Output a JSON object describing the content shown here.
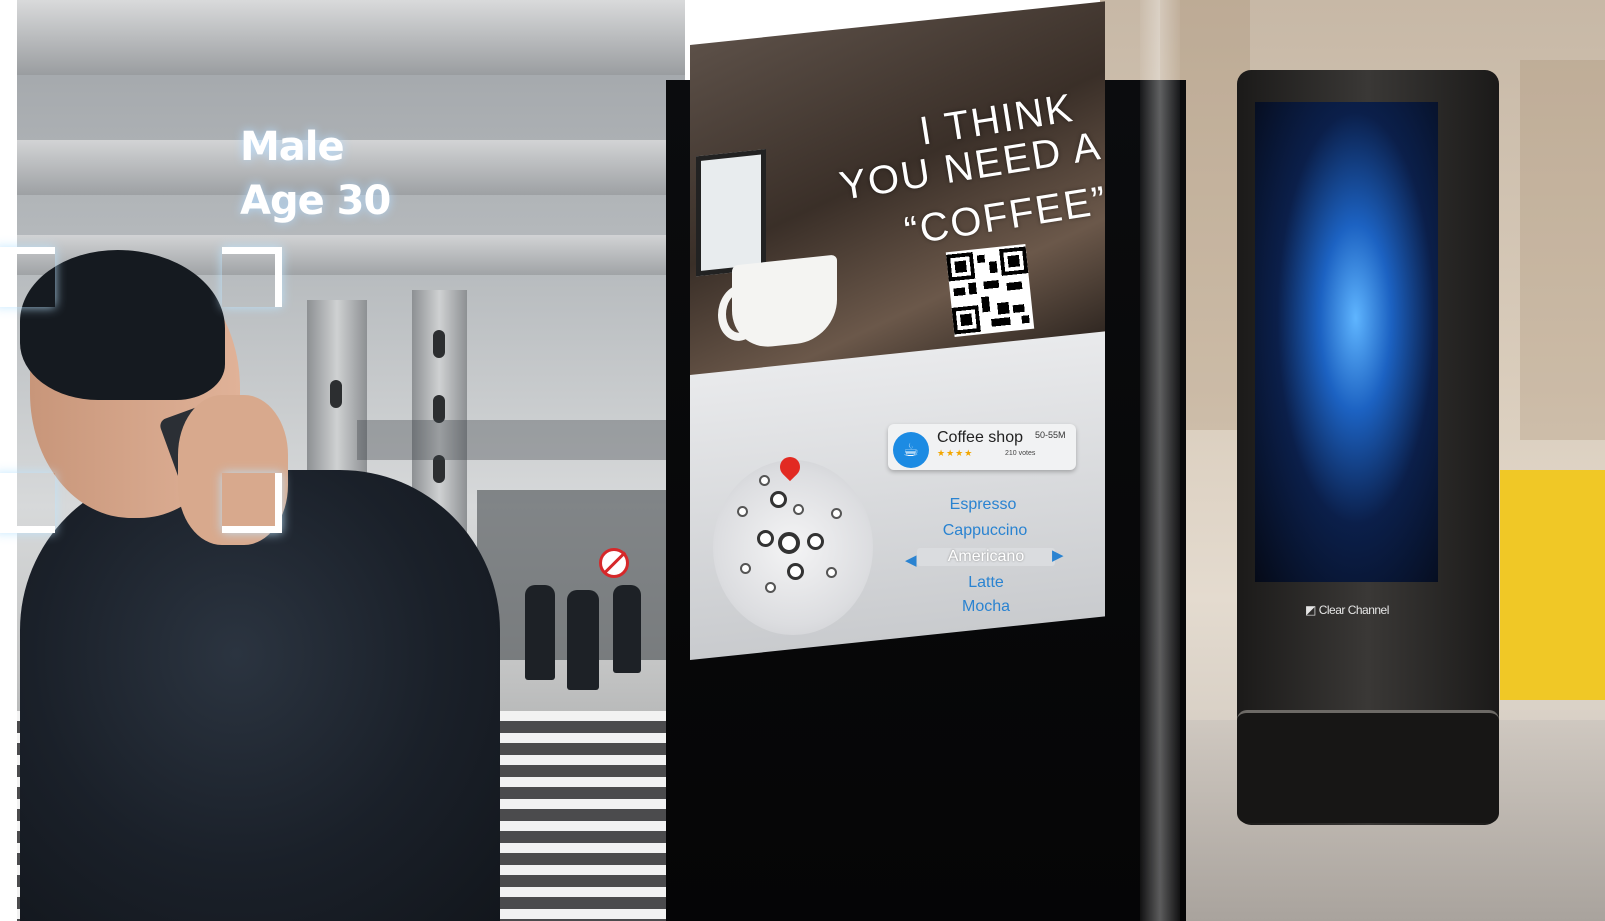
{
  "overlay": {
    "gender_label": "Male",
    "age_label": "Age 30"
  },
  "ad": {
    "headline_line1": "I THINK",
    "headline_line2": "YOU NEED A",
    "headline_line3": "“COFFEE”"
  },
  "shop_card": {
    "name": "Coffee shop",
    "distance": "50-55M",
    "rating_stars": "★★★★",
    "votes": "210 votes"
  },
  "menu": {
    "items": [
      "Espresso",
      "Cappuccino",
      "Americano",
      "Latte",
      "Mocha"
    ],
    "selected": "Americano",
    "arrow_left": "◀",
    "arrow_right": "▶"
  },
  "totem": {
    "brand": "Clear Channel"
  },
  "colors": {
    "accent_blue": "#2a83d1",
    "pin_red": "#e22a22",
    "counter_yellow": "#f0c826"
  },
  "icons": {
    "coffee": "coffee-cup-icon",
    "pin": "map-pin-icon"
  }
}
